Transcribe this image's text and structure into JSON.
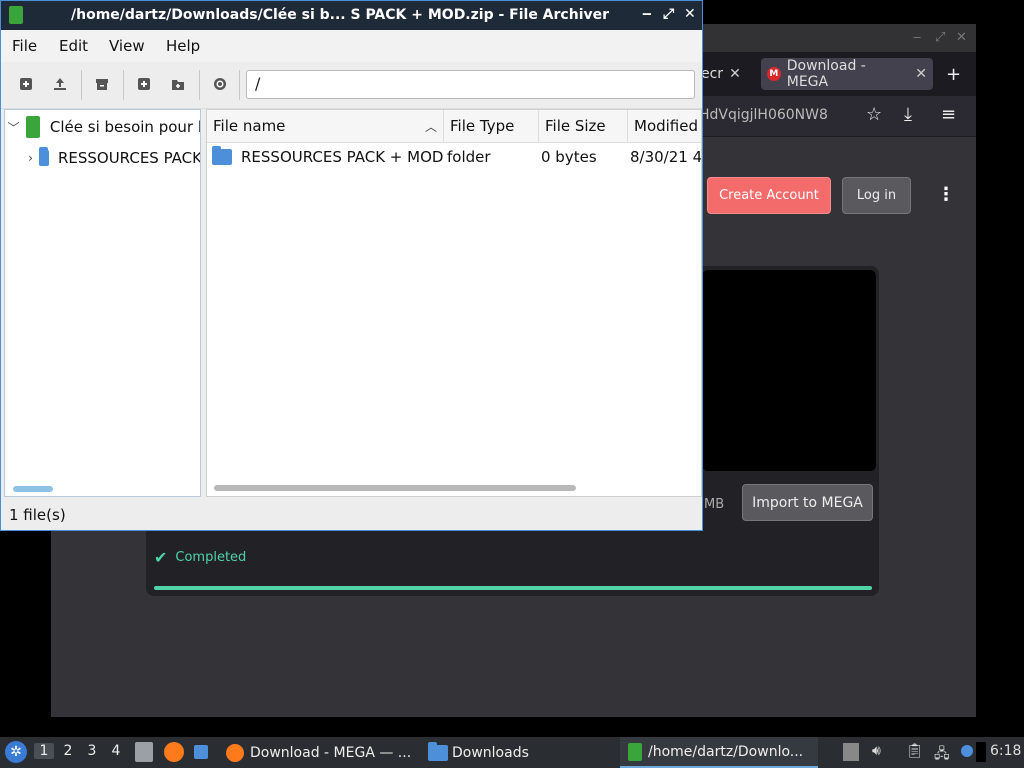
{
  "browser": {
    "tabs": [
      {
        "label": "ecr"
      },
      {
        "label": "Download - MEGA"
      }
    ],
    "url_fragment": "HdVqigjlH060NW8",
    "create_account": "Create Account",
    "login": "Log in",
    "size_fragment": "MB",
    "import": "Import to MEGA",
    "completed": "Completed",
    "progress": 1.0
  },
  "archiver": {
    "title": "/home/dartz/Downloads/Clée si b... S PACK + MOD.zip - File Archiver",
    "menu": [
      "File",
      "Edit",
      "View",
      "Help"
    ],
    "path": "/",
    "tree": {
      "root": "Clée si besoin pour l",
      "child": "RESSOURCES PACK"
    },
    "columns": [
      "File name",
      "File Type",
      "File Size",
      "Modified"
    ],
    "rows": [
      {
        "name": "RESSOURCES PACK + MOD",
        "type": "folder",
        "size": "0 bytes",
        "modified": "8/30/21 4"
      }
    ],
    "status": "1 file(s)"
  },
  "taskbar": {
    "workspaces": [
      "1",
      "2",
      "3",
      "4"
    ],
    "tasks": [
      {
        "label": "Download - MEGA — ..."
      },
      {
        "label": "Downloads"
      },
      {
        "label": "/home/dartz/Downlo..."
      }
    ],
    "clock": "6:18"
  },
  "colors": {
    "accent": "#4a90d9",
    "mega_red": "#d9272e",
    "completed": "#4fd3a6"
  }
}
